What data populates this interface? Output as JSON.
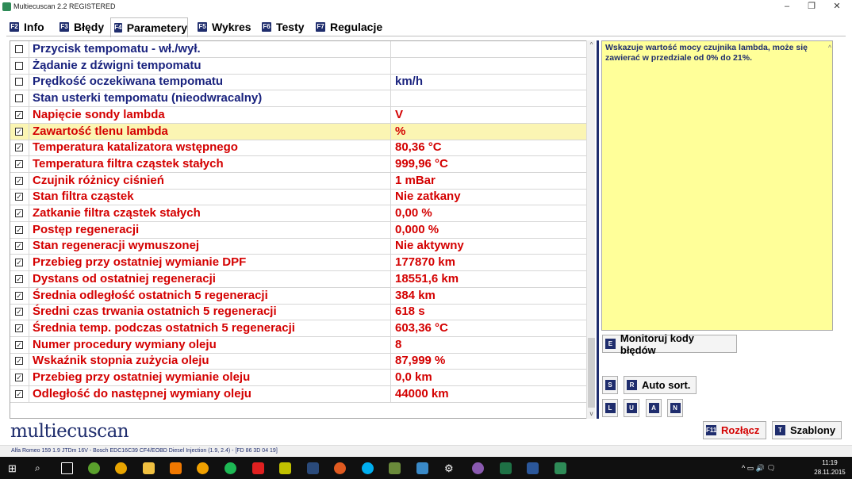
{
  "window": {
    "title": "Multiecuscan 2.2 REGISTERED",
    "min": "–",
    "max": "❐",
    "close": "✕"
  },
  "tabs": [
    {
      "key": "F2",
      "label": "Info"
    },
    {
      "key": "F3",
      "label": "Błędy"
    },
    {
      "key": "F4",
      "label": "Parametery"
    },
    {
      "key": "F5",
      "label": "Wykres"
    },
    {
      "key": "F6",
      "label": "Testy"
    },
    {
      "key": "F7",
      "label": "Regulacje"
    }
  ],
  "colors": {
    "selected_param": "#d40000",
    "unselected_param": "#1a237e",
    "highlight_row": "#fbf5b3",
    "info_bg": "#ffff99",
    "brand_navy": "#1f2d6d"
  },
  "params": [
    {
      "checked": false,
      "name": "Przycisk tempomatu - wł./wył.",
      "value": ""
    },
    {
      "checked": false,
      "name": "Żądanie z dźwigni tempomatu",
      "value": ""
    },
    {
      "checked": false,
      "name": "Prędkość oczekiwana tempomatu",
      "value": "km/h"
    },
    {
      "checked": false,
      "name": "Stan usterki tempomatu (nieodwracalny)",
      "value": ""
    },
    {
      "checked": true,
      "name": "Napięcie sondy lambda",
      "value": "V"
    },
    {
      "checked": true,
      "name": "Zawartość tlenu lambda",
      "value": "%",
      "highlight": true
    },
    {
      "checked": true,
      "name": "Temperatura katalizatora wstępnego",
      "value": "80,36 °C"
    },
    {
      "checked": true,
      "name": "Temperatura filtra cząstek stałych",
      "value": "999,96 °C"
    },
    {
      "checked": true,
      "name": "Czujnik różnicy ciśnień",
      "value": "1 mBar"
    },
    {
      "checked": true,
      "name": "Stan filtra cząstek",
      "value": "Nie zatkany"
    },
    {
      "checked": true,
      "name": "Zatkanie filtra cząstek stałych",
      "value": "0,00 %"
    },
    {
      "checked": true,
      "name": "Postęp regeneracji",
      "value": "0,000 %"
    },
    {
      "checked": true,
      "name": "Stan regeneracji wymuszonej",
      "value": "Nie aktywny"
    },
    {
      "checked": true,
      "name": "Przebieg przy ostatniej wymianie DPF",
      "value": "177870 km"
    },
    {
      "checked": true,
      "name": "Dystans od ostatniej regeneracji",
      "value": "18551,6 km"
    },
    {
      "checked": true,
      "name": "Średnia odległość ostatnich 5 regeneracji",
      "value": "384 km"
    },
    {
      "checked": true,
      "name": "Średni czas trwania ostatnich 5 regeneracji",
      "value": "618 s"
    },
    {
      "checked": true,
      "name": "Średnia temp. podczas ostatnich 5 regeneracji",
      "value": "603,36 °C"
    },
    {
      "checked": true,
      "name": "Numer procedury wymiany oleju",
      "value": "8"
    },
    {
      "checked": true,
      "name": "Wskaźnik stopnia zużycia oleju",
      "value": "87,999 %"
    },
    {
      "checked": true,
      "name": "Przebieg przy ostatniej wymianie oleju",
      "value": "0,0 km"
    },
    {
      "checked": true,
      "name": "Odległość do następnej wymiany oleju",
      "value": "44000 km"
    }
  ],
  "info_text": "Wskazuje wartość mocy czujnika lambda, może się zawierać w przedziale od 0% do 21%.",
  "buttons": {
    "monitor": {
      "key": "E",
      "label": "Monitoruj kody błędów"
    },
    "s_key": "S",
    "autosort": {
      "key": "R",
      "label": "Auto sort."
    },
    "small": [
      "L",
      "U",
      "A",
      "N"
    ],
    "disconnect": {
      "key": "F11",
      "label": "Rozłącz"
    },
    "templates": {
      "key": "T",
      "label": "Szablony"
    }
  },
  "logo": "multiecuscan",
  "status_bar": "Alfa Romeo 159 1.9 JTDm 16V - Bosch EDC16C39 CF4/EOBD Diesel Injection (1.9, 2.4) - [FD 86 3D 04 19]",
  "taskbar": {
    "time": "11:19",
    "date": "28.11.2015",
    "tray": "^ ▭ 🔊 🗨"
  }
}
